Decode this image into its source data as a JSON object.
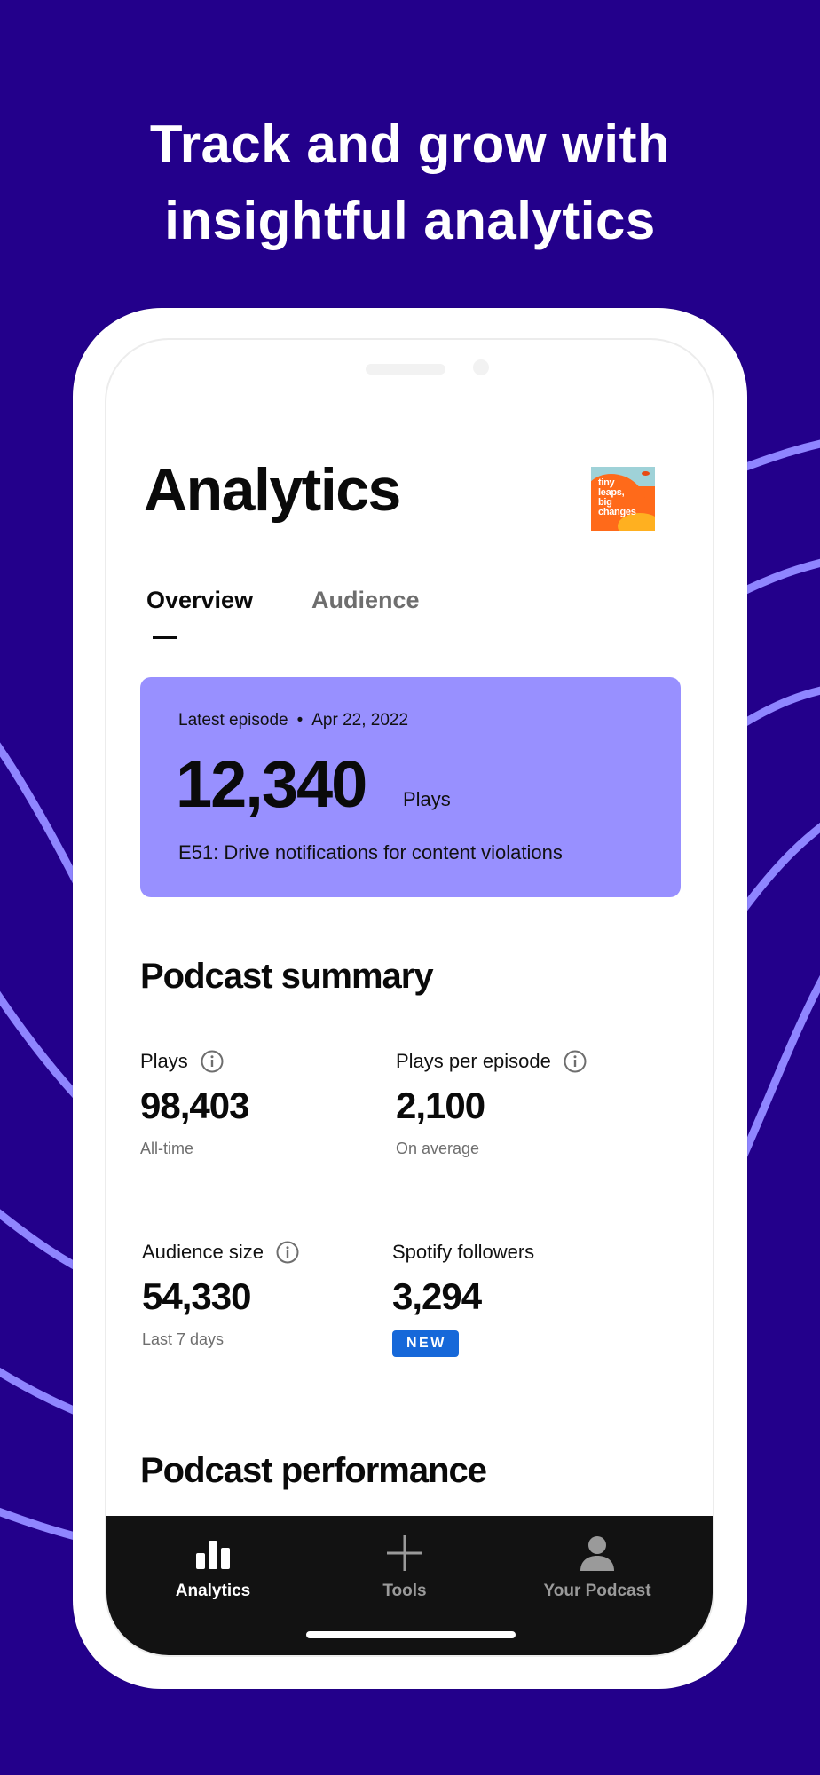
{
  "headline": {
    "line1": "Track and grow with",
    "line2": "insightful analytics"
  },
  "colors": {
    "background": "#23008b",
    "lines": "#8f85ff",
    "episode_card": "#9890ff",
    "badge": "#1668d9",
    "tabbar": "#121212"
  },
  "screen": {
    "title": "Analytics",
    "avatar": {
      "text": "tiny\nleaps,\nbig\nchanges"
    },
    "tabs": [
      {
        "label": "Overview",
        "active": true
      },
      {
        "label": "Audience",
        "active": false
      }
    ],
    "latest_episode": {
      "label": "Latest episode",
      "separator": "•",
      "date": "Apr 22, 2022",
      "plays": "12,340",
      "plays_label": "Plays",
      "title": "E51: Drive notifications for content violations"
    },
    "summary": {
      "title": "Podcast summary",
      "stats": [
        {
          "label": "Plays",
          "value": "98,403",
          "sub": "All-time",
          "icon": "info-icon"
        },
        {
          "label": "Plays per episode",
          "value": "2,100",
          "sub": "On average",
          "icon": "info-icon"
        },
        {
          "label": "Audience size",
          "value": "54,330",
          "sub": "Last 7 days",
          "icon": "info-icon"
        },
        {
          "label": "Spotify followers",
          "value": "3,294",
          "badge": "NEW"
        }
      ]
    },
    "performance_title": "Podcast performance",
    "tabbar": [
      {
        "label": "Analytics",
        "icon": "bar-chart-icon",
        "active": true
      },
      {
        "label": "Tools",
        "icon": "plus-icon",
        "active": false
      },
      {
        "label": "Your Podcast",
        "icon": "person-icon",
        "active": false
      }
    ]
  }
}
